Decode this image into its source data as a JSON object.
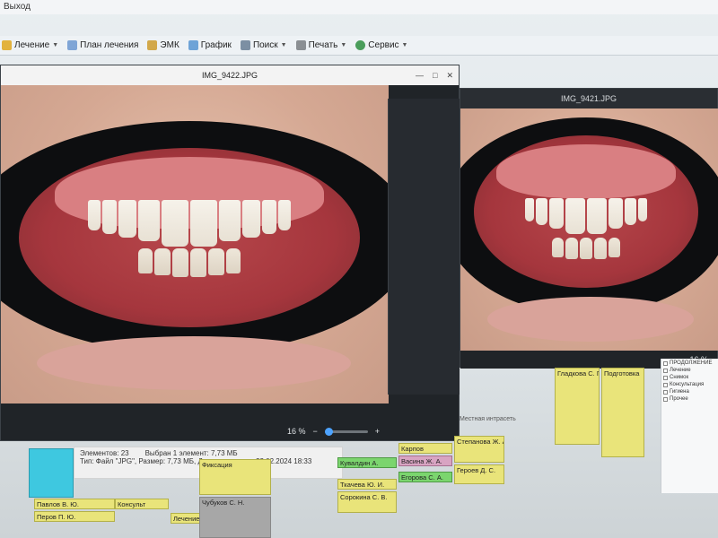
{
  "host": {
    "title_fragment": "Выход",
    "toolbar": [
      {
        "label": "Лечение",
        "icon": "treatment-icon"
      },
      {
        "label": "План лечения",
        "icon": "plan-icon"
      },
      {
        "label": "ЭМК",
        "icon": "emk-icon"
      },
      {
        "label": "График",
        "icon": "graph-icon"
      },
      {
        "label": "Поиск",
        "icon": "search-icon"
      },
      {
        "label": "Печать",
        "icon": "print-icon"
      },
      {
        "label": "Сервис",
        "icon": "service-icon"
      }
    ]
  },
  "viewer_left": {
    "filename": "IMG_9422.JPG",
    "zoom": "16 %",
    "window_controls": [
      "—",
      "□",
      "✕"
    ]
  },
  "viewer_right": {
    "filename": "IMG_9421.JPG",
    "zoom": "16 %"
  },
  "explorer_status": {
    "elements": "Элементов: 23",
    "selected": "Выбран 1 элемент: 7,73 МБ",
    "type_line": "Тип: Файл \"JPG\", Размер: 7,73 МБ, Дата изменения: 22.02.2024 18:33"
  },
  "schedule": {
    "appointments_left": [
      {
        "text": "Павлов В. Ю.",
        "color": "y"
      },
      {
        "text": "Консульт",
        "color": "y"
      },
      {
        "text": "Перов П. Ю.",
        "color": "y"
      },
      {
        "text": "Лечение",
        "color": "y"
      },
      {
        "text": "Чубуков С. Н.",
        "color": "gray"
      },
      {
        "text": "Фиксация",
        "color": "y"
      }
    ],
    "appointments_mid": [
      {
        "text": "Кувалдин А.",
        "color": "g"
      },
      {
        "text": "Карпов",
        "color": "y"
      },
      {
        "text": "Васина Ж. А.",
        "color": "p"
      },
      {
        "text": "Ткачева Ю. И.",
        "color": "y"
      },
      {
        "text": "Егорова С. А.",
        "color": "g"
      },
      {
        "text": "Сорокина С. В.",
        "color": "y"
      }
    ],
    "appointments_right": [
      {
        "text": "Степанова Ж. А.",
        "color": "y"
      },
      {
        "text": "Героев Д. С.",
        "color": "y"
      },
      {
        "text": "Гладкова С. П.",
        "color": "y"
      },
      {
        "text": "Подготовка",
        "color": "y"
      }
    ],
    "right_list": [
      "ПРОДОЛЖЕНИЕ",
      "Лечение",
      "Снимок",
      "Консультация",
      "Гигиена",
      "Прочее"
    ],
    "explorer_location": "Местная интрасеть"
  }
}
